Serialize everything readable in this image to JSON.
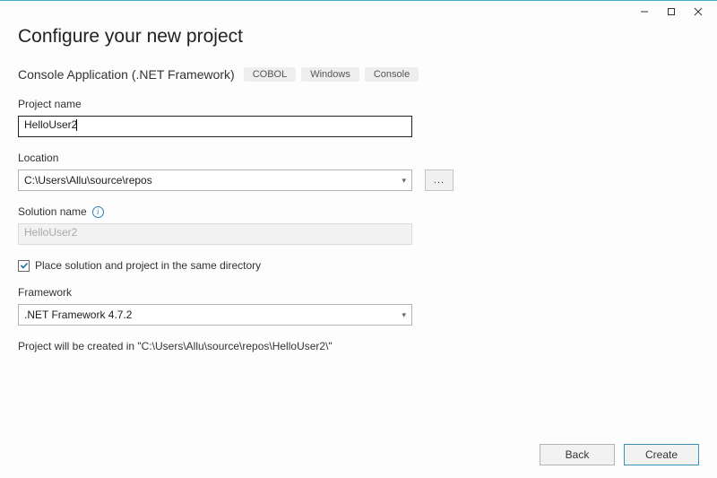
{
  "title": "Configure your new project",
  "subtitle": "Console Application (.NET Framework)",
  "tags": [
    "COBOL",
    "Windows",
    "Console"
  ],
  "labels": {
    "project_name": "Project name",
    "location": "Location",
    "solution_name": "Solution name",
    "framework": "Framework"
  },
  "fields": {
    "project_name_value": "HelloUser2",
    "location_value": "C:\\Users\\Allu\\source\\repos",
    "solution_name_value": "HelloUser2",
    "framework_value": ".NET Framework 4.7.2"
  },
  "checkbox": {
    "checked": true,
    "label": "Place solution and project in the same directory"
  },
  "browse_btn": "...",
  "status_prefix": "Project will be created in ",
  "status_path": "\"C:\\Users\\Allu\\source\\repos\\HelloUser2\\\"",
  "buttons": {
    "back": "Back",
    "create": "Create"
  },
  "info_glyph": "i"
}
